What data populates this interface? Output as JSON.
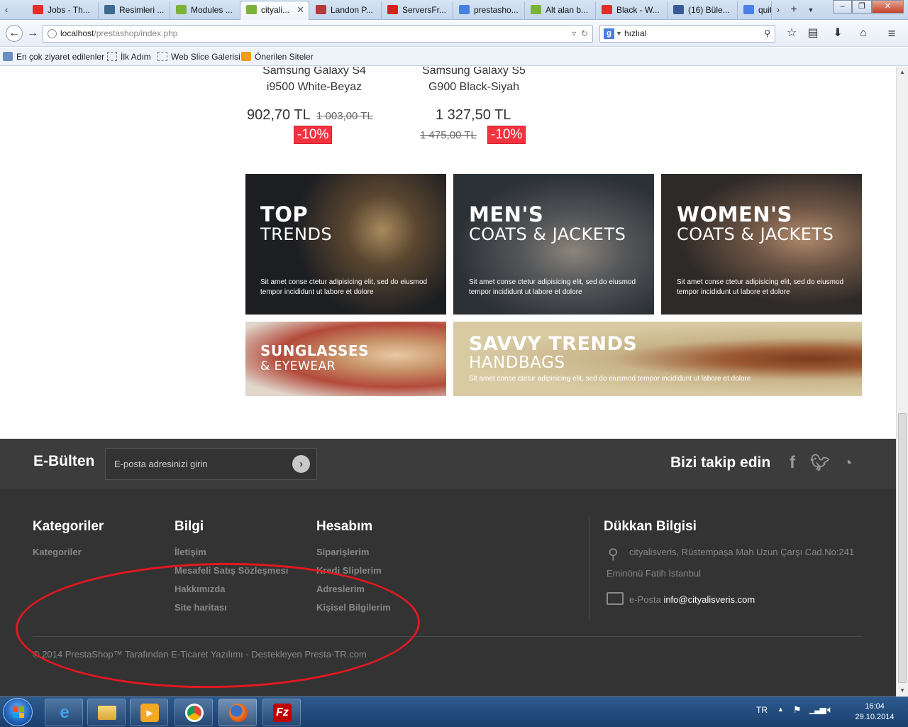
{
  "browser": {
    "tabs": [
      {
        "label": "Jobs - Th...",
        "icon": "youtube-icon",
        "color": "#e52d27"
      },
      {
        "label": "Resimleri ...",
        "icon": "image-host-icon",
        "color": "#3d6b8f"
      },
      {
        "label": "Modules ...",
        "icon": "prestashop-icon",
        "color": "#7bb33a"
      },
      {
        "label": "cityali...",
        "icon": "prestashop-icon",
        "color": "#7bb33a",
        "active": true
      },
      {
        "label": "Landon P...",
        "icon": "theme-icon",
        "color": "#b23b3b"
      },
      {
        "label": "ServersFr...",
        "icon": "sourceforge-icon",
        "color": "#d61f1f"
      },
      {
        "label": "prestasho...",
        "icon": "google-icon",
        "color": "#4a7fe6"
      },
      {
        "label": "Alt alan b...",
        "icon": "prestashop-icon",
        "color": "#7bb33a"
      },
      {
        "label": "Black - W...",
        "icon": "youtube-icon",
        "color": "#e52d27"
      },
      {
        "label": "(16) Büle...",
        "icon": "facebook-icon",
        "color": "#3b5998"
      },
      {
        "label": "quit",
        "icon": "google-icon",
        "color": "#4a7fe6"
      }
    ],
    "url_host": "localhost",
    "url_path": "/prestashop/index.php",
    "search_value": "hızlıal",
    "search_engine_glyph": "g",
    "bookmarks": [
      {
        "label": "En çok ziyaret edilenler",
        "icon": "bookmark-icon"
      },
      {
        "label": "İlk Adım",
        "icon": "page-icon"
      },
      {
        "label": "Web Slice Galerisi",
        "icon": "page-icon"
      },
      {
        "label": "Önerilen Siteler",
        "icon": "suggested-sites-icon"
      }
    ]
  },
  "products": [
    {
      "name_line1": "Samsung Galaxy S4",
      "name_line2": "i9500 White-Beyaz",
      "price": "902,70 TL",
      "old_price": "1 003,00 TL",
      "discount": "-10%"
    },
    {
      "name_line1": "Samsung Galaxy S5",
      "name_line2": "G900 Black-Siyah",
      "price": "1 327,50 TL",
      "old_price": "1 475,00 TL",
      "discount": "-10%"
    }
  ],
  "banners": [
    {
      "title": "TOP",
      "subtitle": "TRENDS",
      "desc1": "Sit amet conse ctetur adipisicing elit, sed do eiusmod",
      "desc2": "tempor incididunt ut labore et dolore"
    },
    {
      "title": "MEN'S",
      "subtitle": "COATS & JACKETS",
      "desc1": "Sit amet conse ctetur adipisicing elit, sed do eiusmod",
      "desc2": "tempor incididunt ut labore et dolore"
    },
    {
      "title": "WOMEN'S",
      "subtitle": "COATS & JACKETS",
      "desc1": "Sit amet conse ctetur adipisicing elit, sed do eiusmod",
      "desc2": "tempor incididunt ut labore et dolore"
    },
    {
      "title": "SUNGLASSES",
      "subtitle": "& EYEWEAR"
    },
    {
      "title": "SAVVY TRENDS",
      "subtitle": "HANDBAGS",
      "desc1": "Sit amet conse ctetur adipisicing elit, sed do eiusmod tempor incididunt ut labore et dolore"
    }
  ],
  "newsletter": {
    "title": "E-Bülten",
    "placeholder": "E-posta adresinizi girin",
    "follow_title": "Bizi takip edin",
    "socials": [
      "facebook-icon",
      "twitter-icon",
      "rss-icon"
    ]
  },
  "footer": {
    "categories": {
      "title": "Kategoriler",
      "links": [
        "Kategoriler"
      ]
    },
    "info": {
      "title": "Bilgi",
      "links": [
        "İletişim",
        "Mesafeli Satış Sözleşmesi",
        "Hakkımızda",
        "Site haritası"
      ]
    },
    "account": {
      "title": "Hesabım",
      "links": [
        "Siparişlerim",
        "Kredi Sliplerim",
        "Adreslerim",
        "Kişisel Bilgilerim"
      ]
    },
    "store": {
      "title": "Dükkan Bilgisi",
      "address_line1": "cityalisveris, Rüstempaşa Mah Uzun Çarşı Cad.No:241",
      "address_line2": "Eminönü Fatih İstanbul",
      "email_label": "e-Posta",
      "email": "info@cityalisveris.com"
    },
    "copyright": "© 2014 PrestaShop™ Tarafından E-Ticaret Yazılımı - Destekleyen Presta-TR.com"
  },
  "taskbar": {
    "apps": [
      "internet-explorer-icon",
      "file-explorer-icon",
      "media-player-icon",
      "chrome-icon",
      "firefox-icon",
      "filezilla-icon"
    ],
    "language": "TR",
    "time": "16:04",
    "date": "29.10.2014"
  },
  "colors": {
    "discount_red": "#f13340",
    "footer_dark": "#333333",
    "annotation_red": "#e21820"
  }
}
